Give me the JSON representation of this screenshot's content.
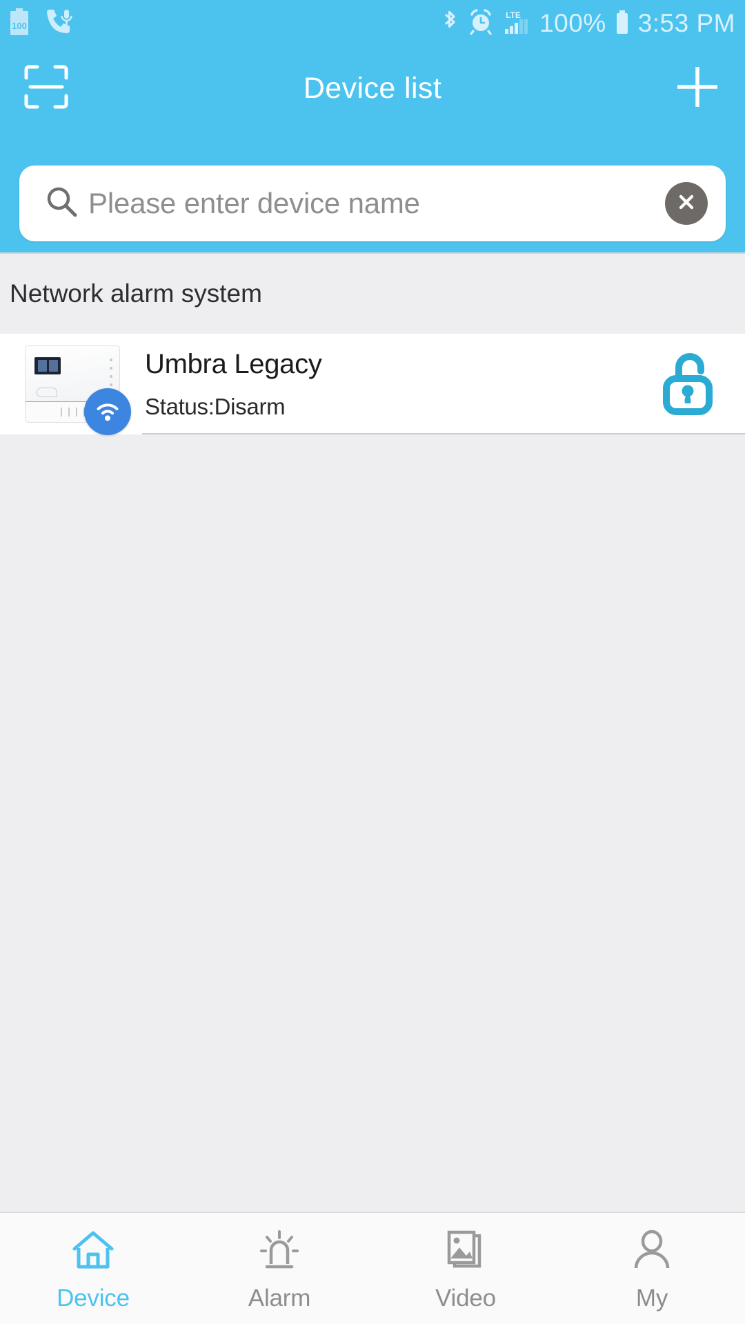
{
  "status_bar": {
    "battery_label": "100",
    "percent": "100%",
    "time": "3:53 PM",
    "left_icons": [
      "battery-100-icon",
      "phone-mic-icon"
    ],
    "right_icons": [
      "bluetooth-icon",
      "alarm-clock-icon",
      "lte-signal-icon",
      "battery-icon"
    ],
    "network_type": "LTE"
  },
  "header": {
    "title": "Device list",
    "scan_icon": "qr-scan-icon",
    "add_icon": "plus-icon"
  },
  "search": {
    "placeholder": "Please enter device name",
    "value": "",
    "search_icon": "search-icon",
    "clear_icon": "clear-circle-icon"
  },
  "device_section": {
    "title": "Network alarm system",
    "devices": [
      {
        "name": "Umbra Legacy",
        "status": "Status:Disarm",
        "thumbnail": "alarm-panel-icon",
        "connectivity_badge": "wifi-icon",
        "lock_state_icon": "unlocked-padlock-icon"
      }
    ]
  },
  "tabbar": {
    "items": [
      {
        "label": "Device",
        "icon": "home-icon",
        "active": true
      },
      {
        "label": "Alarm",
        "icon": "siren-icon",
        "active": false
      },
      {
        "label": "Video",
        "icon": "photos-icon",
        "active": false
      },
      {
        "label": "My",
        "icon": "person-icon",
        "active": false
      }
    ]
  },
  "colors": {
    "accent": "#4cc3ef",
    "header_bg": "#4cc3ef",
    "page_bg": "#eeeef1",
    "card_bg": "#ffffff",
    "lock_teal": "#29abd4",
    "wifi_blue": "#3c85e0",
    "inactive_tab": "#8d8d8d"
  }
}
